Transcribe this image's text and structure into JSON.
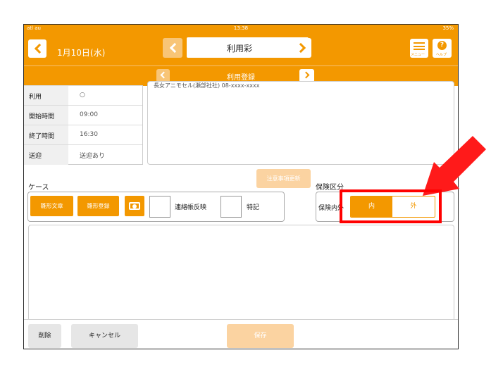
{
  "status_bar": {
    "carrier": "atl au",
    "time": "13:38",
    "battery": "35%"
  },
  "nav": {
    "date": "1月10日(水)",
    "user_select": "利用彩",
    "menu_label": "メニュー",
    "help_label": "ヘルプ",
    "help_glyph": "?"
  },
  "subnav": {
    "title": "利用登録"
  },
  "info": {
    "rows": [
      {
        "label": "利用",
        "value": "○"
      },
      {
        "label": "開始時間",
        "value": "09:00"
      },
      {
        "label": "終了時間",
        "value": "16:30"
      },
      {
        "label": "送迎",
        "value": "送迎あり"
      }
    ]
  },
  "memo": {
    "text": "長女アニモセル(瀬部社社) 08-xxxx-xxxx"
  },
  "note_update_button": "注意事項更新",
  "case": {
    "label": "ケース",
    "buttons": [
      "雛形文章",
      "雛形登録"
    ],
    "camera_icon": "camera-icon",
    "checkboxes": [
      "連絡帳反映",
      "特記"
    ]
  },
  "insurance": {
    "label": "保険区分",
    "prefix": "保険内外",
    "options": [
      "内",
      "外"
    ],
    "selected": "内"
  },
  "footer": {
    "delete": "削除",
    "cancel": "キャンセル",
    "save": "保存"
  },
  "colors": {
    "accent": "#f39800",
    "highlight": "#ff0000",
    "disabled_accent": "#fbd3a1"
  }
}
